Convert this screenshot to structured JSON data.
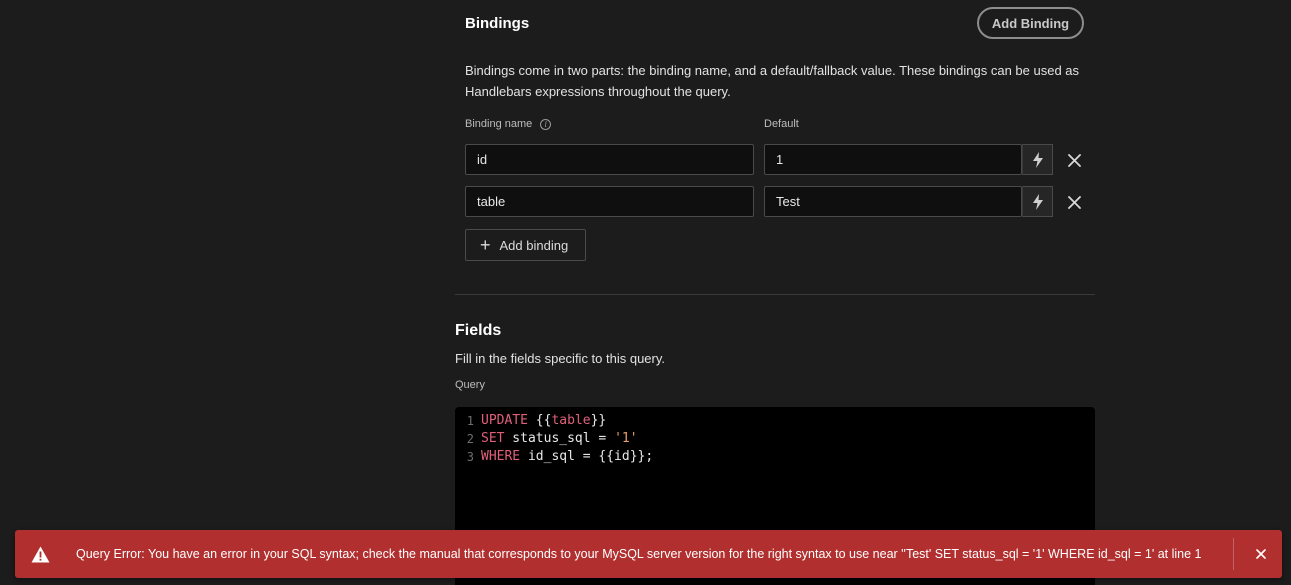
{
  "bindings": {
    "title": "Bindings",
    "add_binding_top_label": "Add Binding",
    "description": "Bindings come in two parts: the binding name, and a default/fallback value. These bindings can be used as Handlebars expressions throughout the query.",
    "name_column_label": "Binding name",
    "default_column_label": "Default",
    "rows": [
      {
        "name": "id",
        "default": "1"
      },
      {
        "name": "table",
        "default": "Test"
      }
    ],
    "add_binding_label": "Add binding"
  },
  "fields": {
    "title": "Fields",
    "description": "Fill in the fields specific to this query.",
    "query_label": "Query"
  },
  "query_editor": {
    "lines": [
      {
        "number": "1",
        "tokens": [
          {
            "t": "UPDATE",
            "c": "kw"
          },
          {
            "t": " {{",
            "c": "plain"
          },
          {
            "t": "table",
            "c": "var"
          },
          {
            "t": "}}",
            "c": "plain"
          }
        ]
      },
      {
        "number": "2",
        "tokens": [
          {
            "t": "SET",
            "c": "kw"
          },
          {
            "t": " status_sql = ",
            "c": "plain"
          },
          {
            "t": "'1'",
            "c": "str"
          }
        ]
      },
      {
        "number": "3",
        "tokens": [
          {
            "t": "WHERE",
            "c": "kw"
          },
          {
            "t": " id_sql = {{id}};",
            "c": "plain"
          }
        ]
      }
    ]
  },
  "toast": {
    "message": "Query Error: You have an error in your SQL syntax; check the manual that corresponds to your MySQL server version for the right syntax to use near ''Test' SET status_sql = '1' WHERE id_sql = 1' at line 1",
    "icon": "warning-icon",
    "color": "#b12f2f"
  },
  "colors": {
    "background": "#1c1c1c",
    "editor_background": "#000000",
    "keyword": "#e0607a",
    "string": "#e9a06b"
  }
}
